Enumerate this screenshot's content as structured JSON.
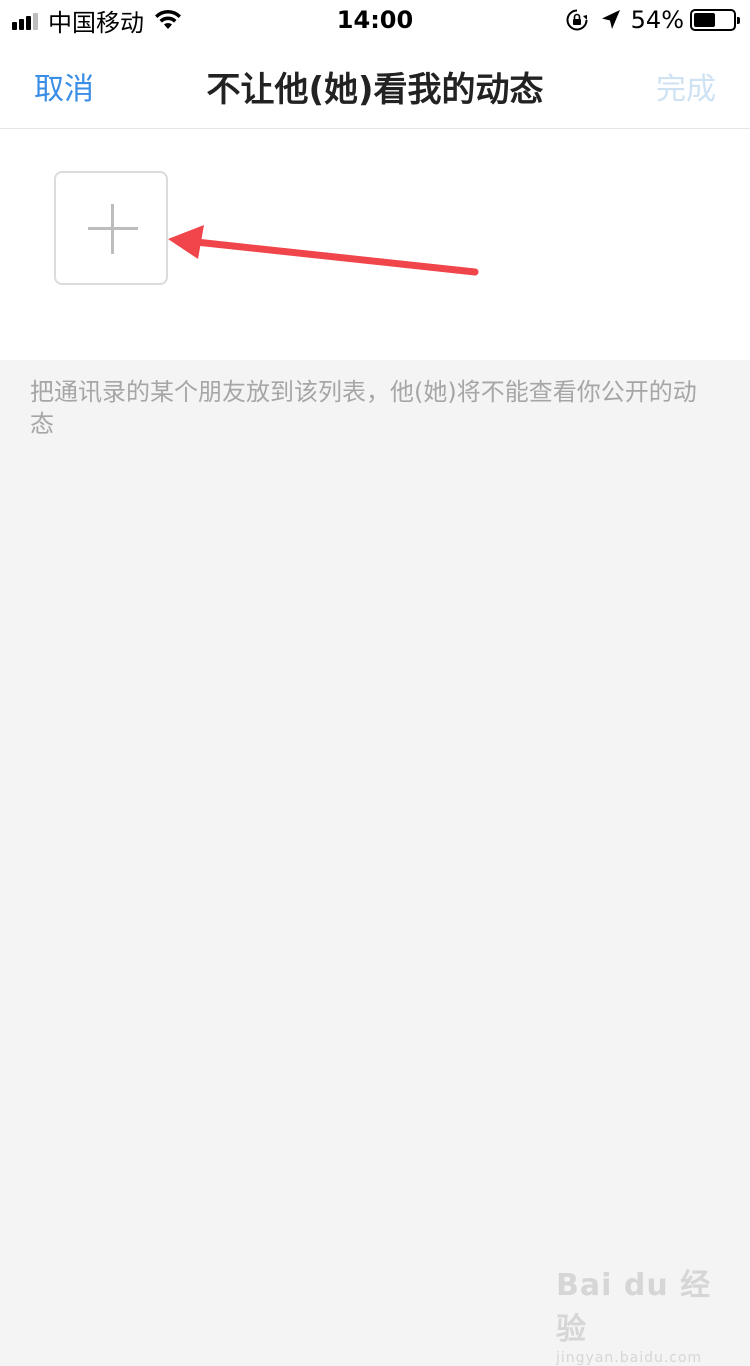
{
  "status_bar": {
    "carrier": "中国移动",
    "time": "14:00",
    "battery_percent": "54%",
    "battery_level": 0.54,
    "icons": [
      "signal-icon",
      "wifi-icon",
      "orientation-lock-icon",
      "location-icon",
      "battery-icon"
    ]
  },
  "nav": {
    "cancel_label": "取消",
    "title": "不让他(她)看我的动态",
    "done_label": "完成"
  },
  "content": {
    "add_button_icon": "plus-icon",
    "hint_text": "把通讯录的某个朋友放到该列表，他(她)将不能查看你公开的动态"
  },
  "watermark": {
    "logo": "Bai du 经验",
    "url": "jingyan.baidu.com"
  },
  "colors": {
    "accent": "#3a8ee6",
    "done_disabled": "#cfe2f3",
    "background": "#f4f4f4",
    "annotation_arrow": "#f0454a"
  }
}
